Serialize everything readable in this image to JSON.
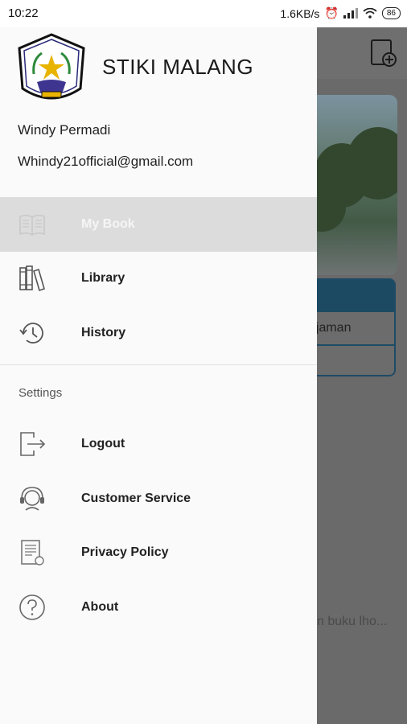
{
  "status": {
    "time": "10:22",
    "speed": "1.6KB/s",
    "battery": "86"
  },
  "background": {
    "card_row1": "njaman",
    "hint": "n buku lho..."
  },
  "drawer": {
    "org_name": "STIKI MALANG",
    "user_name": "Windy Permadi",
    "user_email": "Whindy21official@gmail.com",
    "menu": [
      {
        "label": "My Book",
        "icon": "open-book-icon",
        "active": true
      },
      {
        "label": "Library",
        "icon": "books-shelf-icon",
        "active": false
      },
      {
        "label": "History",
        "icon": "history-icon",
        "active": false
      }
    ],
    "settings_label": "Settings",
    "settings_items": [
      {
        "label": "Logout",
        "icon": "logout-icon"
      },
      {
        "label": "Customer Service",
        "icon": "headset-icon"
      },
      {
        "label": "Privacy Policy",
        "icon": "document-icon"
      },
      {
        "label": "About",
        "icon": "help-icon"
      }
    ]
  }
}
